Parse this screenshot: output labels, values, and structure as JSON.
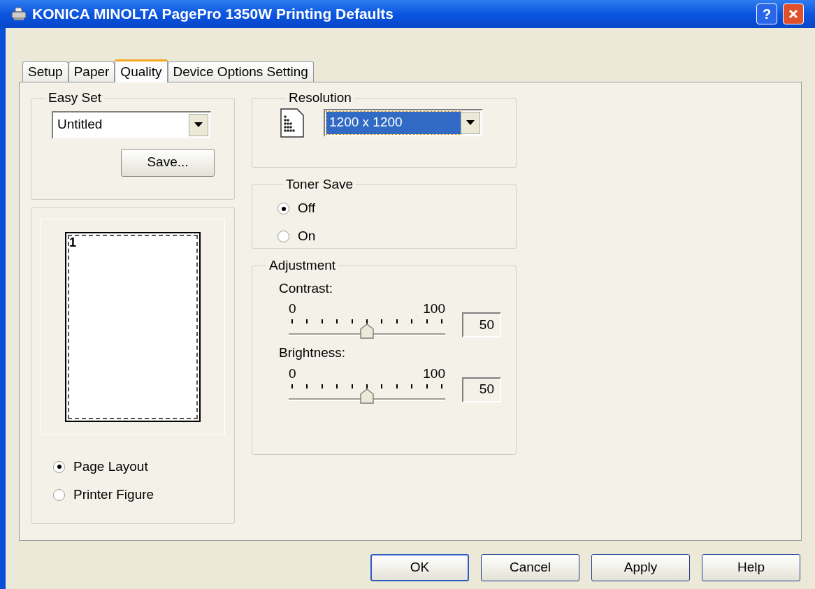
{
  "window": {
    "title": "KONICA MINOLTA PagePro 1350W Printing Defaults",
    "help": "?"
  },
  "tabs": [
    {
      "label": "Setup",
      "selected": false
    },
    {
      "label": "Paper",
      "selected": false
    },
    {
      "label": "Quality",
      "selected": true
    },
    {
      "label": "Device Options Setting",
      "selected": false
    }
  ],
  "easy_set": {
    "title": "Easy Set",
    "value": "Untitled",
    "save": "Save..."
  },
  "preview": {
    "page_number": "1",
    "options": [
      {
        "label": "Page Layout",
        "selected": true
      },
      {
        "label": "Printer Figure",
        "selected": false
      }
    ]
  },
  "resolution": {
    "title": "Resolution",
    "value": "1200 x 1200"
  },
  "toner_save": {
    "title": "Toner Save",
    "options": [
      {
        "label": "Off",
        "selected": true
      },
      {
        "label": "On",
        "selected": false
      }
    ]
  },
  "adjustment": {
    "title": "Adjustment",
    "sliders": [
      {
        "label": "Contrast:",
        "min": "0",
        "max": "100",
        "level": 0.5,
        "reading": "50"
      },
      {
        "label": "Brightness:",
        "min": "0",
        "max": "100",
        "level": 0.5,
        "reading": "50"
      }
    ]
  },
  "buttons": [
    {
      "label": "OK",
      "kind": "default"
    },
    {
      "label": "Cancel",
      "kind": "normal"
    },
    {
      "label": "Apply",
      "kind": "normal"
    },
    {
      "label": "Help",
      "kind": "normal"
    }
  ]
}
